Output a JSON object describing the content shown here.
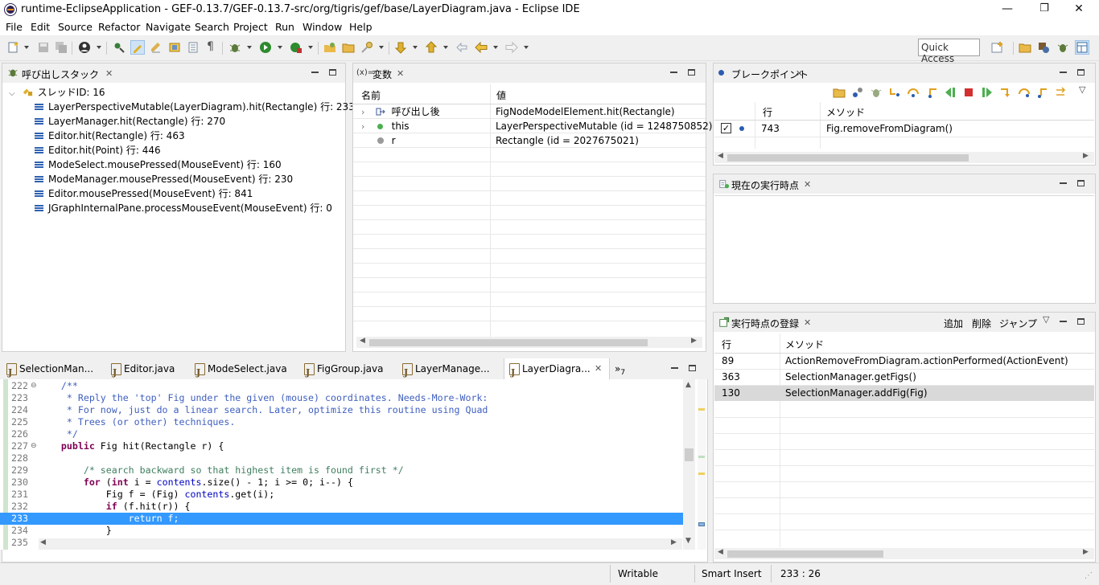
{
  "window": {
    "title": "runtime-EclipseApplication - GEF-0.13.7/GEF-0.13.7-src/org/tigris/gef/base/LayerDiagram.java - Eclipse IDE",
    "controls": {
      "minimize": "—",
      "restore": "❐",
      "close": "✕"
    }
  },
  "menu": [
    "File",
    "Edit",
    "Source",
    "Refactor",
    "Navigate",
    "Search",
    "Project",
    "Run",
    "Window",
    "Help"
  ],
  "toolbar": {
    "quick_access_placeholder": "Quick Access"
  },
  "debug_view": {
    "title": "呼び出しスタック",
    "thread": "スレッドID: 16",
    "frames": [
      "LayerPerspectiveMutable(LayerDiagram).hit(Rectangle) 行: 233",
      "LayerManager.hit(Rectangle) 行: 270",
      "Editor.hit(Rectangle) 行: 463",
      "Editor.hit(Point) 行: 446",
      "ModeSelect.mousePressed(MouseEvent) 行: 160",
      "ModeManager.mousePressed(MouseEvent) 行: 230",
      "Editor.mousePressed(MouseEvent) 行: 841",
      "JGraphInternalPane.processMouseEvent(MouseEvent) 行: 0"
    ]
  },
  "variables_view": {
    "title": "変数",
    "title_prefix": "(x)=",
    "col_name": "名前",
    "col_value": "値",
    "rows": [
      {
        "name": "呼び出し後",
        "value": "FigNodeModelElement.hit(Rectangle)",
        "kind": "return",
        "expandable": true
      },
      {
        "name": "this",
        "value": "LayerPerspectiveMutable  (id = 1248750852)",
        "kind": "field",
        "expandable": true
      },
      {
        "name": "r",
        "value": "Rectangle  (id = 2027675021)",
        "kind": "local",
        "expandable": false
      }
    ]
  },
  "breakpoints_view": {
    "title": "ブレークポイント",
    "col_line": "行",
    "col_method": "メソッド",
    "rows": [
      {
        "checked": true,
        "line": "743",
        "method": "Fig.removeFromDiagram()"
      }
    ]
  },
  "current_point_view": {
    "title": "現在の実行時点"
  },
  "registered_points_view": {
    "title": "実行時点の登録",
    "actions": [
      "追加",
      "削除",
      "ジャンプ"
    ],
    "col_line": "行",
    "col_method": "メソッド",
    "rows": [
      {
        "line": "89",
        "method": "ActionRemoveFromDiagram.actionPerformed(ActionEvent)",
        "selected": false
      },
      {
        "line": "363",
        "method": "SelectionManager.getFigs()",
        "selected": false
      },
      {
        "line": "130",
        "method": "SelectionManager.addFig(Fig)",
        "selected": true
      }
    ]
  },
  "editor": {
    "tabs": [
      "SelectionMan...",
      "Editor.java",
      "ModeSelect.java",
      "FigGroup.java",
      "LayerManage...",
      "LayerDiagra..."
    ],
    "active_tab": "LayerDiagra...",
    "overflow": "»",
    "overflow_count": "7",
    "lines": [
      {
        "n": "222",
        "text": "    /**"
      },
      {
        "n": "223",
        "text": "     * Reply the 'top' Fig under the given (mouse) coordinates. Needs-More-Work:"
      },
      {
        "n": "224",
        "text": "     * For now, just do a linear search. Later, optimize this routine using Quad"
      },
      {
        "n": "225",
        "text": "     * Trees (or other) techniques."
      },
      {
        "n": "226",
        "text": "     */"
      },
      {
        "n": "227",
        "text": "    public Fig hit(Rectangle r) {"
      },
      {
        "n": "228",
        "text": ""
      },
      {
        "n": "229",
        "text": "        /* search backward so that highest item is found first */"
      },
      {
        "n": "230",
        "text": "        for (int i = contents.size() - 1; i >= 0; i--) {"
      },
      {
        "n": "231",
        "text": "            Fig f = (Fig) contents.get(i);"
      },
      {
        "n": "232",
        "text": "            if (f.hit(r)) {"
      },
      {
        "n": "233",
        "text": "                return f;"
      },
      {
        "n": "234",
        "text": "            }"
      },
      {
        "n": "235",
        "text": "        }"
      }
    ]
  },
  "status": {
    "mode": "Writable",
    "insert": "Smart Insert",
    "position": "233 : 26"
  }
}
